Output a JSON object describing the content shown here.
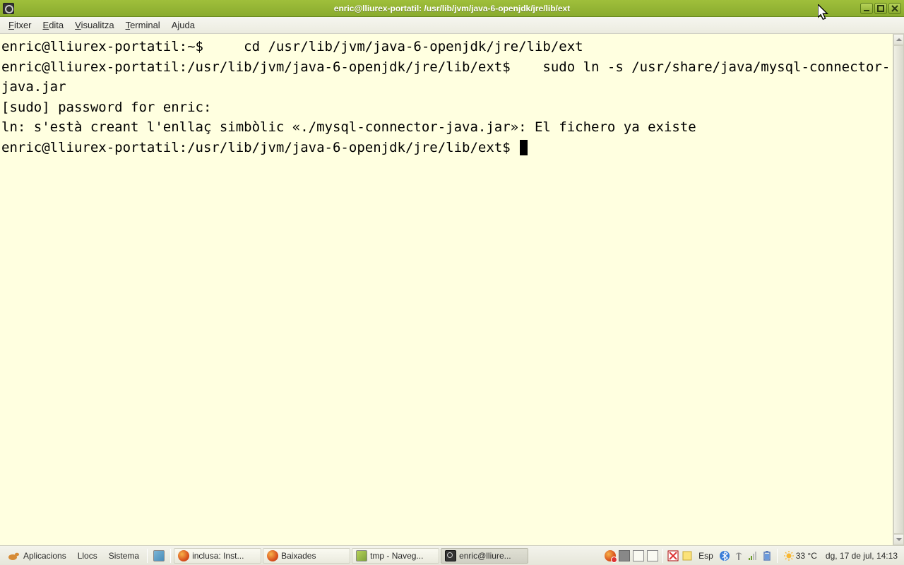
{
  "window": {
    "title": "enric@lliurex-portatil: /usr/lib/jvm/java-6-openjdk/jre/lib/ext"
  },
  "menu": {
    "items": [
      {
        "pre": "",
        "u": "F",
        "post": "itxer"
      },
      {
        "pre": "",
        "u": "E",
        "post": "dita"
      },
      {
        "pre": "",
        "u": "V",
        "post": "isualitza"
      },
      {
        "pre": "",
        "u": "T",
        "post": "erminal"
      },
      {
        "pre": "A",
        "u": "j",
        "post": "uda"
      }
    ]
  },
  "terminal": {
    "lines": [
      "enric@lliurex-portatil:~$     cd /usr/lib/jvm/java-6-openjdk/jre/lib/ext",
      "enric@lliurex-portatil:/usr/lib/jvm/java-6-openjdk/jre/lib/ext$    sudo ln -s /usr/share/java/mysql-connector-java.jar",
      "[sudo] password for enric: ",
      "ln: s'està creant l'enllaç simbòlic «./mysql-connector-java.jar»: El fichero ya existe",
      "enric@lliurex-portatil:/usr/lib/jvm/java-6-openjdk/jre/lib/ext$ "
    ]
  },
  "panel": {
    "apps_label": "Aplicacions",
    "places_label": "Llocs",
    "system_label": "Sistema",
    "tasks": [
      {
        "label": "inclusa: Inst...",
        "icon_color": "#d96f1c",
        "active": false
      },
      {
        "label": "Baixades",
        "icon_color": "#d96f1c",
        "active": false
      },
      {
        "label": "tmp - Naveg...",
        "icon_color": "#7ea23a",
        "active": false
      },
      {
        "label": "enric@lliure...",
        "icon_color": "#333333",
        "active": true
      }
    ],
    "keyboard": "Esp",
    "temp": "33 °C",
    "clock": "dg, 17 de jul, 14:13"
  }
}
